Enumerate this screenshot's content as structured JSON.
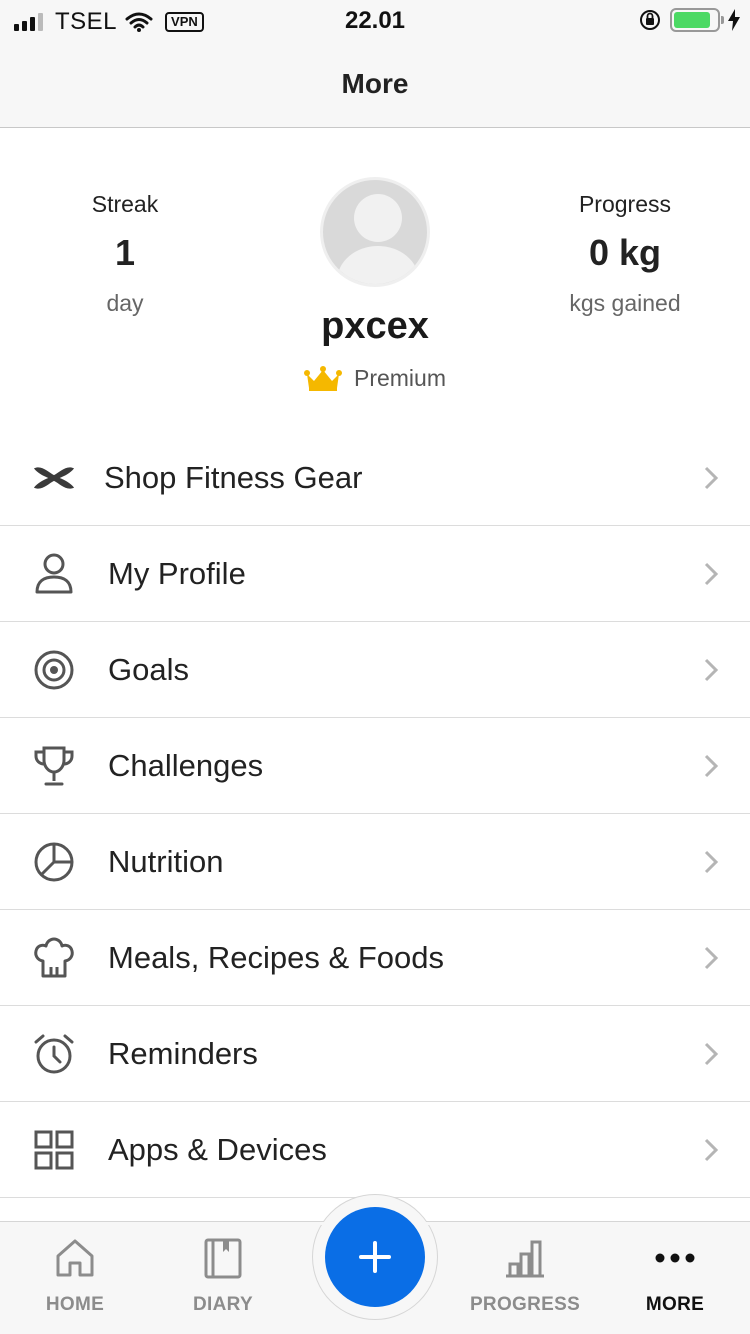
{
  "status_bar": {
    "carrier": "TSEL",
    "vpn_label": "VPN",
    "time": "22.01",
    "battery_level": 0.85,
    "battery_color": "#4cd964"
  },
  "header": {
    "title": "More"
  },
  "profile": {
    "streak": {
      "label": "Streak",
      "value": "1",
      "unit": "day"
    },
    "progress": {
      "label": "Progress",
      "value": "0 kg",
      "unit": "kgs gained"
    },
    "username": "pxcex",
    "membership": "Premium",
    "membership_icon": "crown-icon",
    "crown_color": "#f5b800"
  },
  "menu": [
    {
      "label": "Shop Fitness Gear",
      "icon": "under-armour-logo-icon"
    },
    {
      "label": "My Profile",
      "icon": "person-icon"
    },
    {
      "label": "Goals",
      "icon": "target-icon"
    },
    {
      "label": "Challenges",
      "icon": "trophy-icon"
    },
    {
      "label": "Nutrition",
      "icon": "pie-chart-icon"
    },
    {
      "label": "Meals, Recipes & Foods",
      "icon": "chef-hat-icon"
    },
    {
      "label": "Reminders",
      "icon": "alarm-clock-icon"
    },
    {
      "label": "Apps & Devices",
      "icon": "grid-icon"
    }
  ],
  "tab_bar": {
    "tabs": [
      {
        "label": "HOME",
        "icon": "home-icon"
      },
      {
        "label": "DIARY",
        "icon": "book-icon"
      },
      {
        "label": "PROGRESS",
        "icon": "bar-chart-icon"
      },
      {
        "label": "MORE",
        "icon": "more-dots-icon"
      }
    ],
    "active_tab": "MORE",
    "fab_icon": "plus-icon",
    "fab_color": "#0a6ee6"
  }
}
